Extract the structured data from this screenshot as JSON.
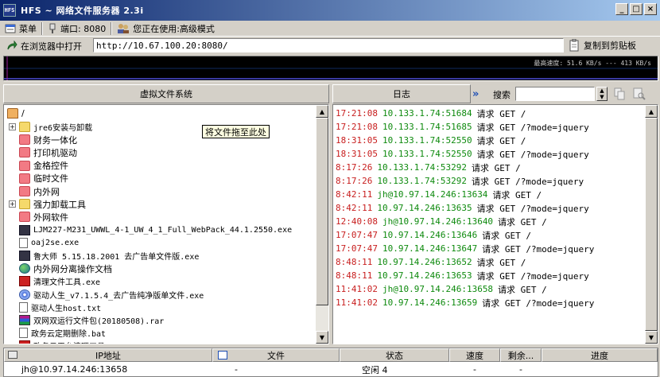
{
  "window": {
    "title": "HFS ~ 网络文件服务器 2.3i",
    "app_icon_text": "HFS",
    "controls": {
      "minimize": "_",
      "maximize": "□",
      "close": "×"
    }
  },
  "toolbar": {
    "menu_label": "菜单",
    "port_label": "端口: 8080",
    "mode_label": "您正在使用:高级模式",
    "open_in_browser_label": "在浏览器中打开",
    "url": "http://10.67.100.20:8080/",
    "copy_clipboard_label": "复制到剪贴板"
  },
  "graph": {
    "speed_text": "最高速度: 51.6 KB/s --- 413 KB/s"
  },
  "vfs": {
    "header": "虚拟文件系统",
    "root_label": "/",
    "items": [
      {
        "label": "jre6安装与卸载",
        "icon": "folder-icon",
        "expandable": true
      },
      {
        "label": "财务一体化",
        "icon": "red-folder-icon",
        "expandable": false
      },
      {
        "label": "打印机驱动",
        "icon": "red-folder-icon",
        "expandable": false
      },
      {
        "label": "金格控件",
        "icon": "red-folder-icon",
        "expandable": false
      },
      {
        "label": "临时文件",
        "icon": "red-folder-icon",
        "expandable": false
      },
      {
        "label": "内外网",
        "icon": "red-folder-icon",
        "expandable": false
      },
      {
        "label": "强力卸载工具",
        "icon": "folder-icon",
        "expandable": true
      },
      {
        "label": "外网软件",
        "icon": "red-folder-icon",
        "expandable": false
      },
      {
        "label": "LJM227-M231_UWWL_4-1_UW_4_1_Full_WebPack_44.1.2550.exe",
        "icon": "installer-icon",
        "expandable": false
      },
      {
        "label": "oaj2se.exe",
        "icon": "java-icon",
        "expandable": false
      },
      {
        "label": "鲁大师 5.15.18.2001 去广告单文件版.exe",
        "icon": "app-icon",
        "expandable": false
      },
      {
        "label": "内外网分离操作文档",
        "icon": "globe-icon",
        "expandable": false
      },
      {
        "label": "清理文件工具.exe",
        "icon": "tool-icon",
        "expandable": false
      },
      {
        "label": "驱动人生_v7.1.5.4_去广告纯净版单文件.exe",
        "icon": "disc-icon",
        "expandable": false
      },
      {
        "label": "驱动人生host.txt",
        "icon": "text-file-icon",
        "expandable": false
      },
      {
        "label": "双网双运行文件包(20180508).rar",
        "icon": "rar-icon",
        "expandable": false
      },
      {
        "label": "政务云定期删除.bat",
        "icon": "file-icon",
        "expandable": false
      },
      {
        "label": "政务云平台清理工具.exe",
        "icon": "tool-icon",
        "expandable": false
      }
    ],
    "tooltip": "将文件拖至此处"
  },
  "log": {
    "header": "日志",
    "search_label": "搜索",
    "search_value": "",
    "entries": [
      {
        "time": "17:21:08",
        "addr": "10.133.1.74:51684",
        "msg": "请求 GET /"
      },
      {
        "time": "17:21:08",
        "addr": "10.133.1.74:51685",
        "msg": "请求 GET /?mode=jquery"
      },
      {
        "time": "18:31:05",
        "addr": "10.133.1.74:52550",
        "msg": "请求 GET /"
      },
      {
        "time": "18:31:05",
        "addr": "10.133.1.74:52550",
        "msg": "请求 GET /?mode=jquery"
      },
      {
        "time": "8:17:26",
        "addr": "10.133.1.74:53292",
        "msg": "请求 GET /"
      },
      {
        "time": "8:17:26",
        "addr": "10.133.1.74:53292",
        "msg": "请求 GET /?mode=jquery"
      },
      {
        "time": "8:42:11",
        "addr": "jh@10.97.14.246:13634",
        "msg": "请求 GET /"
      },
      {
        "time": "8:42:11",
        "addr": "10.97.14.246:13635",
        "msg": "请求 GET /?mode=jquery"
      },
      {
        "time": "12:40:08",
        "addr": "jh@10.97.14.246:13640",
        "msg": "请求 GET /"
      },
      {
        "time": "17:07:47",
        "addr": "10.97.14.246:13646",
        "msg": "请求 GET /"
      },
      {
        "time": "17:07:47",
        "addr": "10.97.14.246:13647",
        "msg": "请求 GET /?mode=jquery"
      },
      {
        "time": "8:48:11",
        "addr": "10.97.14.246:13652",
        "msg": "请求 GET /"
      },
      {
        "time": "8:48:11",
        "addr": "10.97.14.246:13653",
        "msg": "请求 GET /?mode=jquery"
      },
      {
        "time": "11:41:02",
        "addr": "jh@10.97.14.246:13658",
        "msg": "请求 GET /"
      },
      {
        "time": "11:41:02",
        "addr": "10.97.14.246:13659",
        "msg": "请求 GET /?mode=jquery"
      }
    ]
  },
  "connections": {
    "columns": [
      "IP地址",
      "文件",
      "状态",
      "速度",
      "剩余...",
      "进度"
    ],
    "rows": [
      {
        "ip": "jh@10.97.14.246:13658",
        "file": "-",
        "status": "空闲 4",
        "speed": "-",
        "remaining": "-",
        "progress": ""
      }
    ]
  },
  "colors": {
    "title_gradient_start": "#0a246a",
    "title_gradient_end": "#a6caf0",
    "log_time": "#c81e1e",
    "log_addr": "#0e8a0e",
    "face": "#d4d0c8"
  }
}
